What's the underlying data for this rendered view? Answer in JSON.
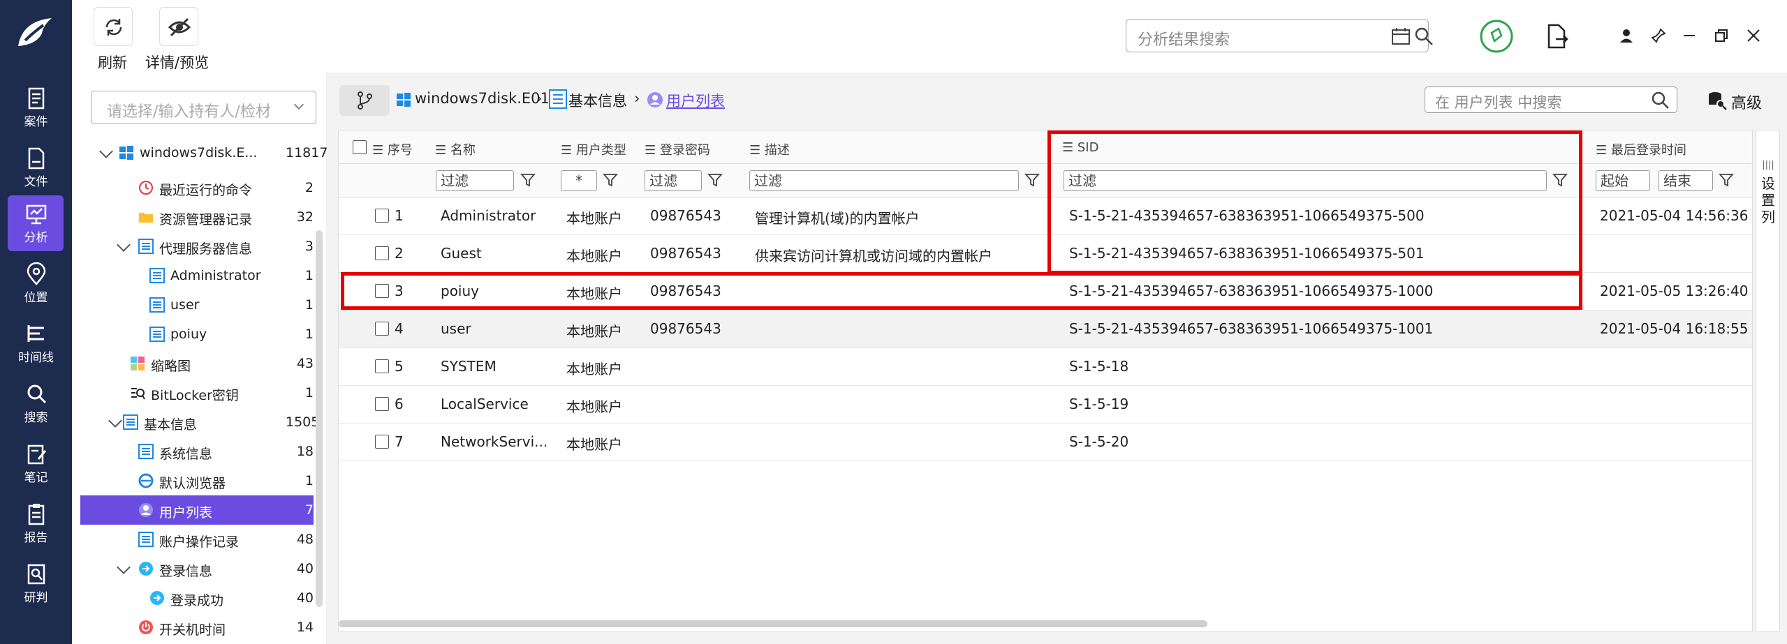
{
  "toolbar": {
    "refresh_label": "刷新",
    "detail_label": "详情/预览"
  },
  "top_search": {
    "placeholder": "分析结果搜索"
  },
  "nav": [
    {
      "label": "案件",
      "icon": "case-icon"
    },
    {
      "label": "文件",
      "icon": "file-icon"
    },
    {
      "label": "分析",
      "icon": "analysis-icon"
    },
    {
      "label": "位置",
      "icon": "location-icon"
    },
    {
      "label": "时间线",
      "icon": "timeline-icon"
    },
    {
      "label": "搜索",
      "icon": "search-icon"
    },
    {
      "label": "笔记",
      "icon": "notes-icon"
    },
    {
      "label": "报告",
      "icon": "report-icon"
    },
    {
      "label": "研判",
      "icon": "judge-icon"
    }
  ],
  "holder_select": {
    "placeholder": "请选择/输入持有人/检材"
  },
  "tree": [
    {
      "label": "windows7disk.E...",
      "count": "11817"
    },
    {
      "label": "最近运行的命令",
      "count": "2"
    },
    {
      "label": "资源管理器记录",
      "count": "32"
    },
    {
      "label": "代理服务器信息",
      "count": "3"
    },
    {
      "label": "Administrator",
      "count": "1"
    },
    {
      "label": "user",
      "count": "1"
    },
    {
      "label": "poiuy",
      "count": "1"
    },
    {
      "label": "缩略图",
      "count": "43"
    },
    {
      "label": "BitLocker密钥",
      "count": "1"
    },
    {
      "label": "基本信息",
      "count": "1505"
    },
    {
      "label": "系统信息",
      "count": "18"
    },
    {
      "label": "默认浏览器",
      "count": "1"
    },
    {
      "label": "用户列表",
      "count": "7"
    },
    {
      "label": "账户操作记录",
      "count": "48"
    },
    {
      "label": "登录信息",
      "count": "40"
    },
    {
      "label": "登录成功",
      "count": "40"
    },
    {
      "label": "开关机时间",
      "count": "14"
    }
  ],
  "breadcrumb": {
    "root": "windows7disk.E01",
    "level2": "基本信息",
    "current": "用户列表"
  },
  "list_search": {
    "placeholder": "在 用户列表 中搜索"
  },
  "advanced_label": "高级",
  "columns": {
    "seq": "序号",
    "name": "名称",
    "type": "用户类型",
    "password": "登录密码",
    "desc": "描述",
    "sid": "SID",
    "last_login": "最后登录时间"
  },
  "filters": {
    "placeholder": "过滤",
    "type_value": "*",
    "start": "起始",
    "end": "结束"
  },
  "rows": [
    {
      "seq": "1",
      "name": "Administrator",
      "type": "本地账户",
      "password": "09876543",
      "desc": "管理计算机(域)的内置帐户",
      "sid": "S-1-5-21-435394657-638363951-1066549375-500",
      "last_login": "2021-05-04 14:56:36"
    },
    {
      "seq": "2",
      "name": "Guest",
      "type": "本地账户",
      "password": "09876543",
      "desc": "供来宾访问计算机或访问域的内置帐户",
      "sid": "S-1-5-21-435394657-638363951-1066549375-501",
      "last_login": ""
    },
    {
      "seq": "3",
      "name": "poiuy",
      "type": "本地账户",
      "password": "09876543",
      "desc": "",
      "sid": "S-1-5-21-435394657-638363951-1066549375-1000",
      "last_login": "2021-05-05 13:26:40"
    },
    {
      "seq": "4",
      "name": "user",
      "type": "本地账户",
      "password": "09876543",
      "desc": "",
      "sid": "S-1-5-21-435394657-638363951-1066549375-1001",
      "last_login": "2021-05-04 16:18:55"
    },
    {
      "seq": "5",
      "name": "SYSTEM",
      "type": "本地账户",
      "password": "",
      "desc": "",
      "sid": "S-1-5-18",
      "last_login": ""
    },
    {
      "seq": "6",
      "name": "LocalService",
      "type": "本地账户",
      "password": "",
      "desc": "",
      "sid": "S-1-5-19",
      "last_login": ""
    },
    {
      "seq": "7",
      "name": "NetworkServi...",
      "type": "本地账户",
      "password": "",
      "desc": "",
      "sid": "S-1-5-20",
      "last_login": ""
    }
  ],
  "settings_col_label": "设置列",
  "colors": {
    "nav_bg": "#1d2b4e",
    "accent": "#6a4de0",
    "highlight": "#e60000"
  }
}
